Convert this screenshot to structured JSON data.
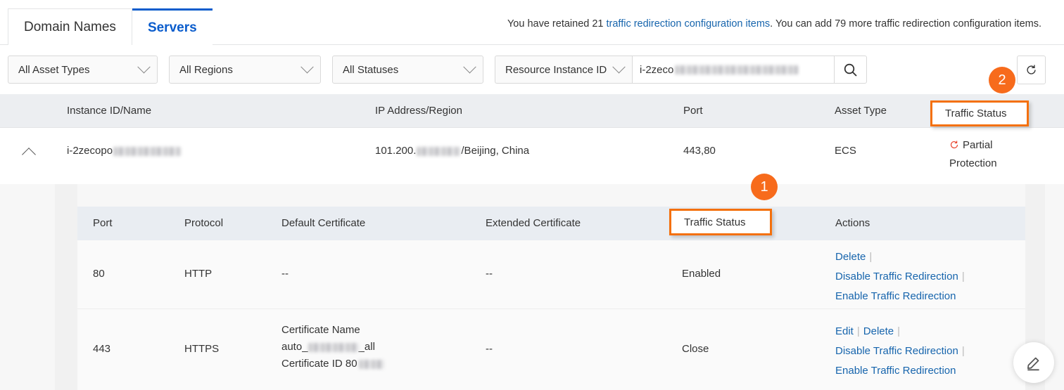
{
  "tabs": [
    {
      "label": "Domain Names",
      "active": false
    },
    {
      "label": "Servers",
      "active": true
    }
  ],
  "notice": {
    "prefix": "You have retained 21 ",
    "link": "traffic redirection configuration items",
    "suffix": ". You can add 79 more traffic redirection configuration items."
  },
  "filters": {
    "asset_type": "All Asset Types",
    "region": "All Regions",
    "status": "All Statuses",
    "search_field": "Resource Instance ID",
    "search_value": "i-2zeco",
    "search_icon": "search-icon",
    "refresh_icon": "refresh-icon"
  },
  "callouts": {
    "one": "1",
    "two": "2",
    "accent": "#f76b1c"
  },
  "outer_table": {
    "columns": [
      "Instance ID/Name",
      "IP Address/Region",
      "Port",
      "Asset Type",
      "Traffic Status"
    ],
    "row": {
      "instance": "i-2zecopo",
      "ip": "101.200.",
      "ip_suffix": "/Beijing, China",
      "port": "443,80",
      "asset_type": "ECS",
      "traffic_status": "Partial Protection",
      "status_icon": "refresh-circle-icon"
    }
  },
  "inner_table": {
    "columns": [
      "Port",
      "Protocol",
      "Default Certificate",
      "Extended Certificate",
      "Traffic Status",
      "Actions"
    ],
    "rows": [
      {
        "port": "80",
        "protocol": "HTTP",
        "default_certificate": "--",
        "extended_certificate": "--",
        "traffic_status": "Enabled",
        "actions": [
          "Delete",
          "Disable Traffic Redirection",
          "Enable Traffic Redirection"
        ]
      },
      {
        "port": "443",
        "protocol": "HTTPS",
        "cert_name_label": "Certificate Name",
        "cert_name_prefix": "auto_",
        "cert_name_suffix": "_all",
        "cert_id_label": "Certificate ID 80",
        "extended_certificate": "--",
        "traffic_status": "Close",
        "actions": [
          "Edit",
          "Delete",
          "Disable Traffic Redirection",
          "Enable Traffic Redirection"
        ]
      }
    ]
  },
  "fab": {
    "icon": "pencil-edit-icon"
  }
}
